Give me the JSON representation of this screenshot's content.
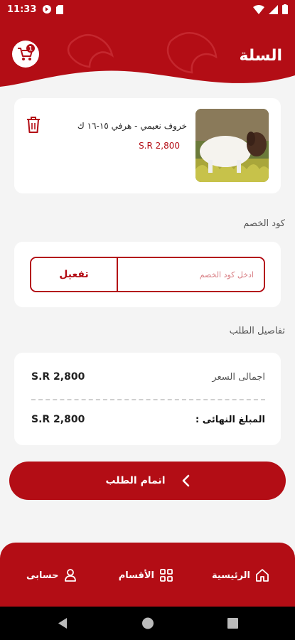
{
  "status_bar": {
    "time": "11:33"
  },
  "header": {
    "title": "السلة",
    "cart_count": "1"
  },
  "cart_item": {
    "name": "خروف نعيمي - هرفي ١٥-١٦ ك",
    "price": "S.R 2,800"
  },
  "coupon": {
    "section_label": "كود الخصم",
    "placeholder": "ادخل كود الخصم",
    "button_label": "تفعيل"
  },
  "order_details": {
    "section_label": "تفاصيل الطلب",
    "total_label": "اجمالى السعر",
    "total_value": "S.R 2,800",
    "final_label": "المبلغ النهائى :",
    "final_value": "S.R 2,800"
  },
  "checkout": {
    "label": "اتمام الطلب"
  },
  "bottom_nav": {
    "home": "الرئيسية",
    "categories": "الأقسام",
    "account": "حسابى"
  },
  "colors": {
    "brand": "#b30d15"
  }
}
